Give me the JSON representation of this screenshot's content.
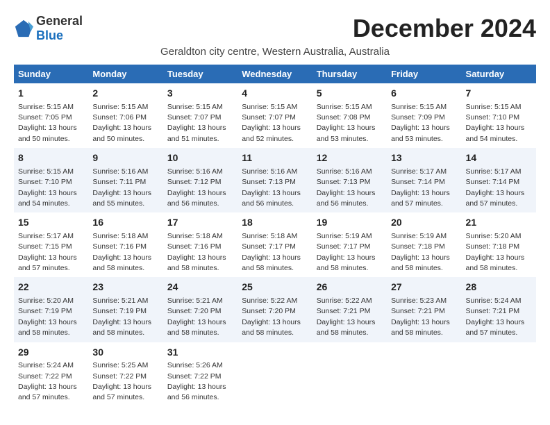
{
  "logo": {
    "general": "General",
    "blue": "Blue"
  },
  "title": "December 2024",
  "subtitle": "Geraldton city centre, Western Australia, Australia",
  "days_header": [
    "Sunday",
    "Monday",
    "Tuesday",
    "Wednesday",
    "Thursday",
    "Friday",
    "Saturday"
  ],
  "weeks": [
    [
      {
        "day": "1",
        "sunrise": "5:15 AM",
        "sunset": "7:05 PM",
        "daylight": "13 hours and 50 minutes."
      },
      {
        "day": "2",
        "sunrise": "5:15 AM",
        "sunset": "7:06 PM",
        "daylight": "13 hours and 50 minutes."
      },
      {
        "day": "3",
        "sunrise": "5:15 AM",
        "sunset": "7:07 PM",
        "daylight": "13 hours and 51 minutes."
      },
      {
        "day": "4",
        "sunrise": "5:15 AM",
        "sunset": "7:07 PM",
        "daylight": "13 hours and 52 minutes."
      },
      {
        "day": "5",
        "sunrise": "5:15 AM",
        "sunset": "7:08 PM",
        "daylight": "13 hours and 53 minutes."
      },
      {
        "day": "6",
        "sunrise": "5:15 AM",
        "sunset": "7:09 PM",
        "daylight": "13 hours and 53 minutes."
      },
      {
        "day": "7",
        "sunrise": "5:15 AM",
        "sunset": "7:10 PM",
        "daylight": "13 hours and 54 minutes."
      }
    ],
    [
      {
        "day": "8",
        "sunrise": "5:15 AM",
        "sunset": "7:10 PM",
        "daylight": "13 hours and 54 minutes."
      },
      {
        "day": "9",
        "sunrise": "5:16 AM",
        "sunset": "7:11 PM",
        "daylight": "13 hours and 55 minutes."
      },
      {
        "day": "10",
        "sunrise": "5:16 AM",
        "sunset": "7:12 PM",
        "daylight": "13 hours and 56 minutes."
      },
      {
        "day": "11",
        "sunrise": "5:16 AM",
        "sunset": "7:13 PM",
        "daylight": "13 hours and 56 minutes."
      },
      {
        "day": "12",
        "sunrise": "5:16 AM",
        "sunset": "7:13 PM",
        "daylight": "13 hours and 56 minutes."
      },
      {
        "day": "13",
        "sunrise": "5:17 AM",
        "sunset": "7:14 PM",
        "daylight": "13 hours and 57 minutes."
      },
      {
        "day": "14",
        "sunrise": "5:17 AM",
        "sunset": "7:14 PM",
        "daylight": "13 hours and 57 minutes."
      }
    ],
    [
      {
        "day": "15",
        "sunrise": "5:17 AM",
        "sunset": "7:15 PM",
        "daylight": "13 hours and 57 minutes."
      },
      {
        "day": "16",
        "sunrise": "5:18 AM",
        "sunset": "7:16 PM",
        "daylight": "13 hours and 58 minutes."
      },
      {
        "day": "17",
        "sunrise": "5:18 AM",
        "sunset": "7:16 PM",
        "daylight": "13 hours and 58 minutes."
      },
      {
        "day": "18",
        "sunrise": "5:18 AM",
        "sunset": "7:17 PM",
        "daylight": "13 hours and 58 minutes."
      },
      {
        "day": "19",
        "sunrise": "5:19 AM",
        "sunset": "7:17 PM",
        "daylight": "13 hours and 58 minutes."
      },
      {
        "day": "20",
        "sunrise": "5:19 AM",
        "sunset": "7:18 PM",
        "daylight": "13 hours and 58 minutes."
      },
      {
        "day": "21",
        "sunrise": "5:20 AM",
        "sunset": "7:18 PM",
        "daylight": "13 hours and 58 minutes."
      }
    ],
    [
      {
        "day": "22",
        "sunrise": "5:20 AM",
        "sunset": "7:19 PM",
        "daylight": "13 hours and 58 minutes."
      },
      {
        "day": "23",
        "sunrise": "5:21 AM",
        "sunset": "7:19 PM",
        "daylight": "13 hours and 58 minutes."
      },
      {
        "day": "24",
        "sunrise": "5:21 AM",
        "sunset": "7:20 PM",
        "daylight": "13 hours and 58 minutes."
      },
      {
        "day": "25",
        "sunrise": "5:22 AM",
        "sunset": "7:20 PM",
        "daylight": "13 hours and 58 minutes."
      },
      {
        "day": "26",
        "sunrise": "5:22 AM",
        "sunset": "7:21 PM",
        "daylight": "13 hours and 58 minutes."
      },
      {
        "day": "27",
        "sunrise": "5:23 AM",
        "sunset": "7:21 PM",
        "daylight": "13 hours and 58 minutes."
      },
      {
        "day": "28",
        "sunrise": "5:24 AM",
        "sunset": "7:21 PM",
        "daylight": "13 hours and 57 minutes."
      }
    ],
    [
      {
        "day": "29",
        "sunrise": "5:24 AM",
        "sunset": "7:22 PM",
        "daylight": "13 hours and 57 minutes."
      },
      {
        "day": "30",
        "sunrise": "5:25 AM",
        "sunset": "7:22 PM",
        "daylight": "13 hours and 57 minutes."
      },
      {
        "day": "31",
        "sunrise": "5:26 AM",
        "sunset": "7:22 PM",
        "daylight": "13 hours and 56 minutes."
      },
      null,
      null,
      null,
      null
    ]
  ],
  "labels": {
    "sunrise": "Sunrise:",
    "sunset": "Sunset:",
    "daylight": "Daylight:"
  }
}
